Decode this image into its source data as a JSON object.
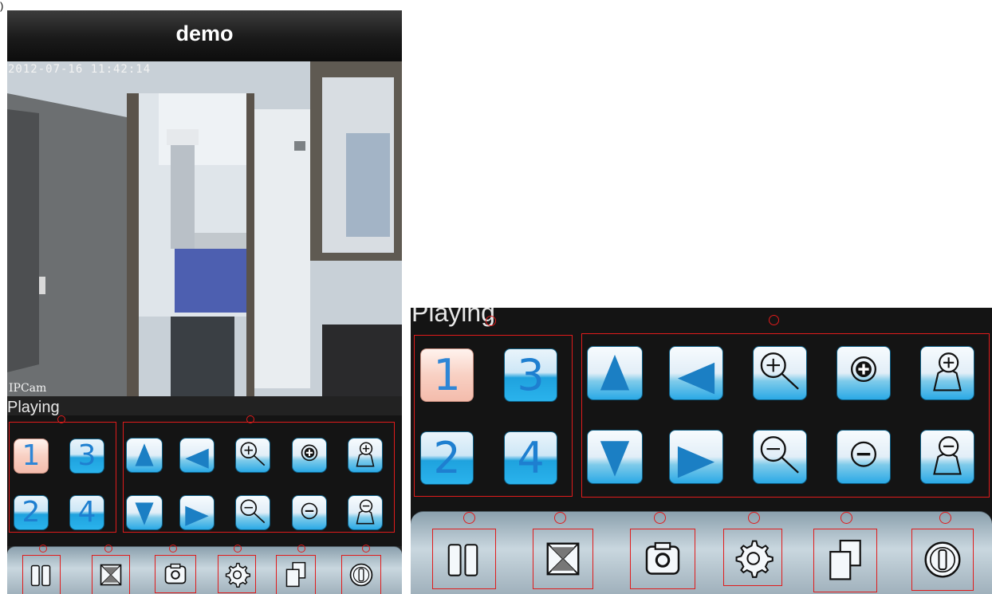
{
  "corner_mark": ")",
  "app": {
    "title": "demo"
  },
  "video": {
    "timestamp": "2012-07-16 11:42:14",
    "camera_label": "IPCam"
  },
  "status": {
    "text": "Playing"
  },
  "channels": [
    {
      "label": "1",
      "selected": true
    },
    {
      "label": "3",
      "selected": false
    },
    {
      "label": "2",
      "selected": false
    },
    {
      "label": "4",
      "selected": false
    }
  ],
  "ptz_controls": [
    {
      "icon": "arrow-up-icon"
    },
    {
      "icon": "arrow-left-icon"
    },
    {
      "icon": "zoom-in-icon"
    },
    {
      "icon": "plus-circle-icon"
    },
    {
      "icon": "focus-in-icon"
    },
    {
      "icon": "arrow-down-icon"
    },
    {
      "icon": "arrow-right-icon"
    },
    {
      "icon": "zoom-out-icon"
    },
    {
      "icon": "minus-circle-icon"
    },
    {
      "icon": "focus-out-icon"
    }
  ],
  "toolbar": [
    {
      "icon": "pause-icon"
    },
    {
      "icon": "close-view-icon"
    },
    {
      "icon": "camera-icon"
    },
    {
      "icon": "gear-icon"
    },
    {
      "icon": "multi-view-icon"
    },
    {
      "icon": "info-icon"
    }
  ],
  "colors": {
    "accent_red": "#e01b1b",
    "button_blue": "#1fa2de",
    "selected_pink": "#f4bcac"
  }
}
